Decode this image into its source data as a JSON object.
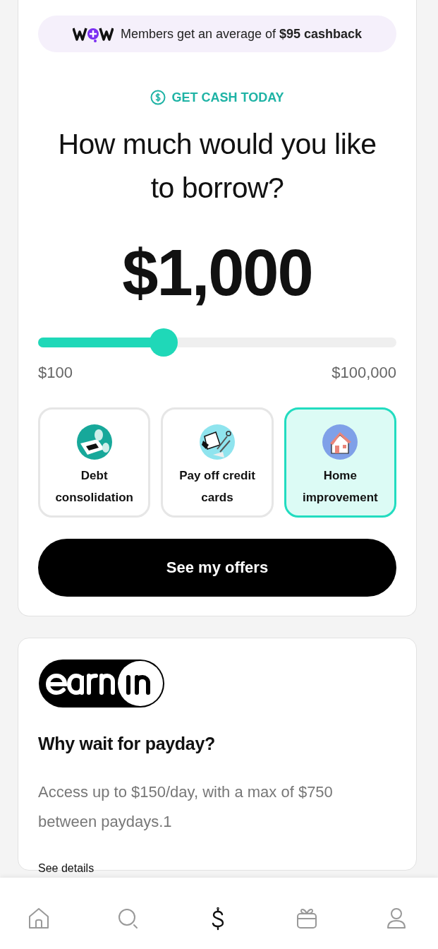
{
  "promo": {
    "text": "Members get an average of **$95 cashback**"
  },
  "borrow": {
    "eyebrow": "GET CASH TODAY",
    "heading": "How much would you like to borrow?",
    "amount": "$1,000",
    "slider": {
      "level": 0.35,
      "min_label": "$100",
      "max_label": "$100,000"
    },
    "purposes": [
      {
        "kind": "debt",
        "label": "Debt consolidation",
        "selected": false
      },
      {
        "kind": "cards",
        "label": "Pay off credit cards",
        "selected": false
      },
      {
        "kind": "home",
        "label": "Home improvement",
        "selected": true
      }
    ],
    "button": "See my offers"
  },
  "earnin": {
    "heading": "Why wait for payday?",
    "body": "Access up to $150/day, with a max of $750 between paydays.1",
    "link": "See details"
  },
  "nav": [
    {
      "kind": "home",
      "selected": false
    },
    {
      "kind": "search",
      "selected": false
    },
    {
      "kind": "dollar",
      "selected": true
    },
    {
      "kind": "gift",
      "selected": false
    },
    {
      "kind": "profile",
      "selected": false
    }
  ]
}
